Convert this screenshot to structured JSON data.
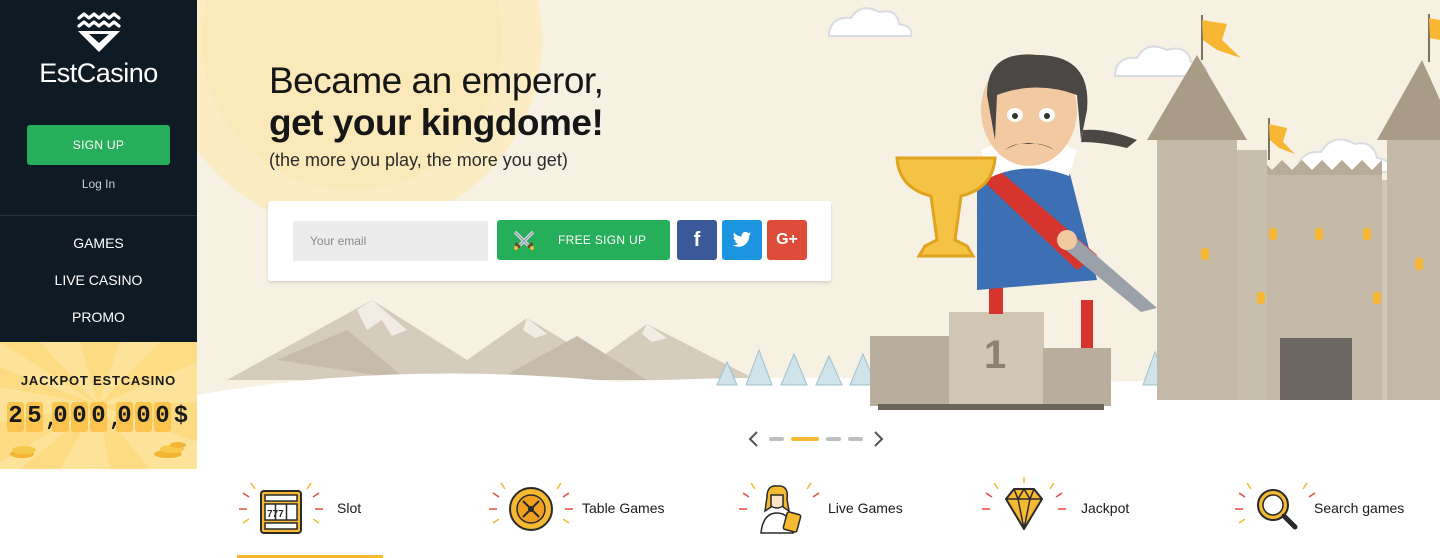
{
  "sidebar": {
    "logo_text": "EstCasino",
    "signup_label": "SIGN UP",
    "login_label": "Log In",
    "nav": [
      {
        "label": "GAMES"
      },
      {
        "label": "LIVE CASINO"
      },
      {
        "label": "PROMO"
      }
    ],
    "jackpot": {
      "title": "JACKPOT ESTCASINO",
      "digits": [
        "2",
        "5",
        "0",
        "0",
        "0",
        "0",
        "0",
        "0"
      ],
      "currency": "$"
    }
  },
  "hero": {
    "headline_line1": "Became an emperor,",
    "headline_line2": "get your kingdome!",
    "subline": "(the more you play, the more you get)",
    "email_placeholder": "Your email",
    "free_signup_label": "FREE SIGN UP",
    "social": {
      "facebook": "f",
      "twitter": "twitter-bird",
      "google_plus": "G+"
    },
    "slider": {
      "slides": 4,
      "active_index": 1
    },
    "podium_number": "1"
  },
  "categories": [
    {
      "label": "Slot",
      "icon": "slot-machine-icon"
    },
    {
      "label": "Table Games",
      "icon": "roulette-icon"
    },
    {
      "label": "Live Games",
      "icon": "live-dealer-icon"
    },
    {
      "label": "Jackpot",
      "icon": "diamond-icon"
    },
    {
      "label": "Search games",
      "icon": "magnifier-icon"
    }
  ],
  "colors": {
    "sidebar_bg": "#0f1b24",
    "green": "#27ae5a",
    "jackpot_bg": "#fde39a",
    "jackpot_digit": "#fbc44f",
    "accent": "#f5b932",
    "facebook": "#3b5998",
    "twitter": "#1b95e0",
    "google_plus": "#dd4b39"
  }
}
